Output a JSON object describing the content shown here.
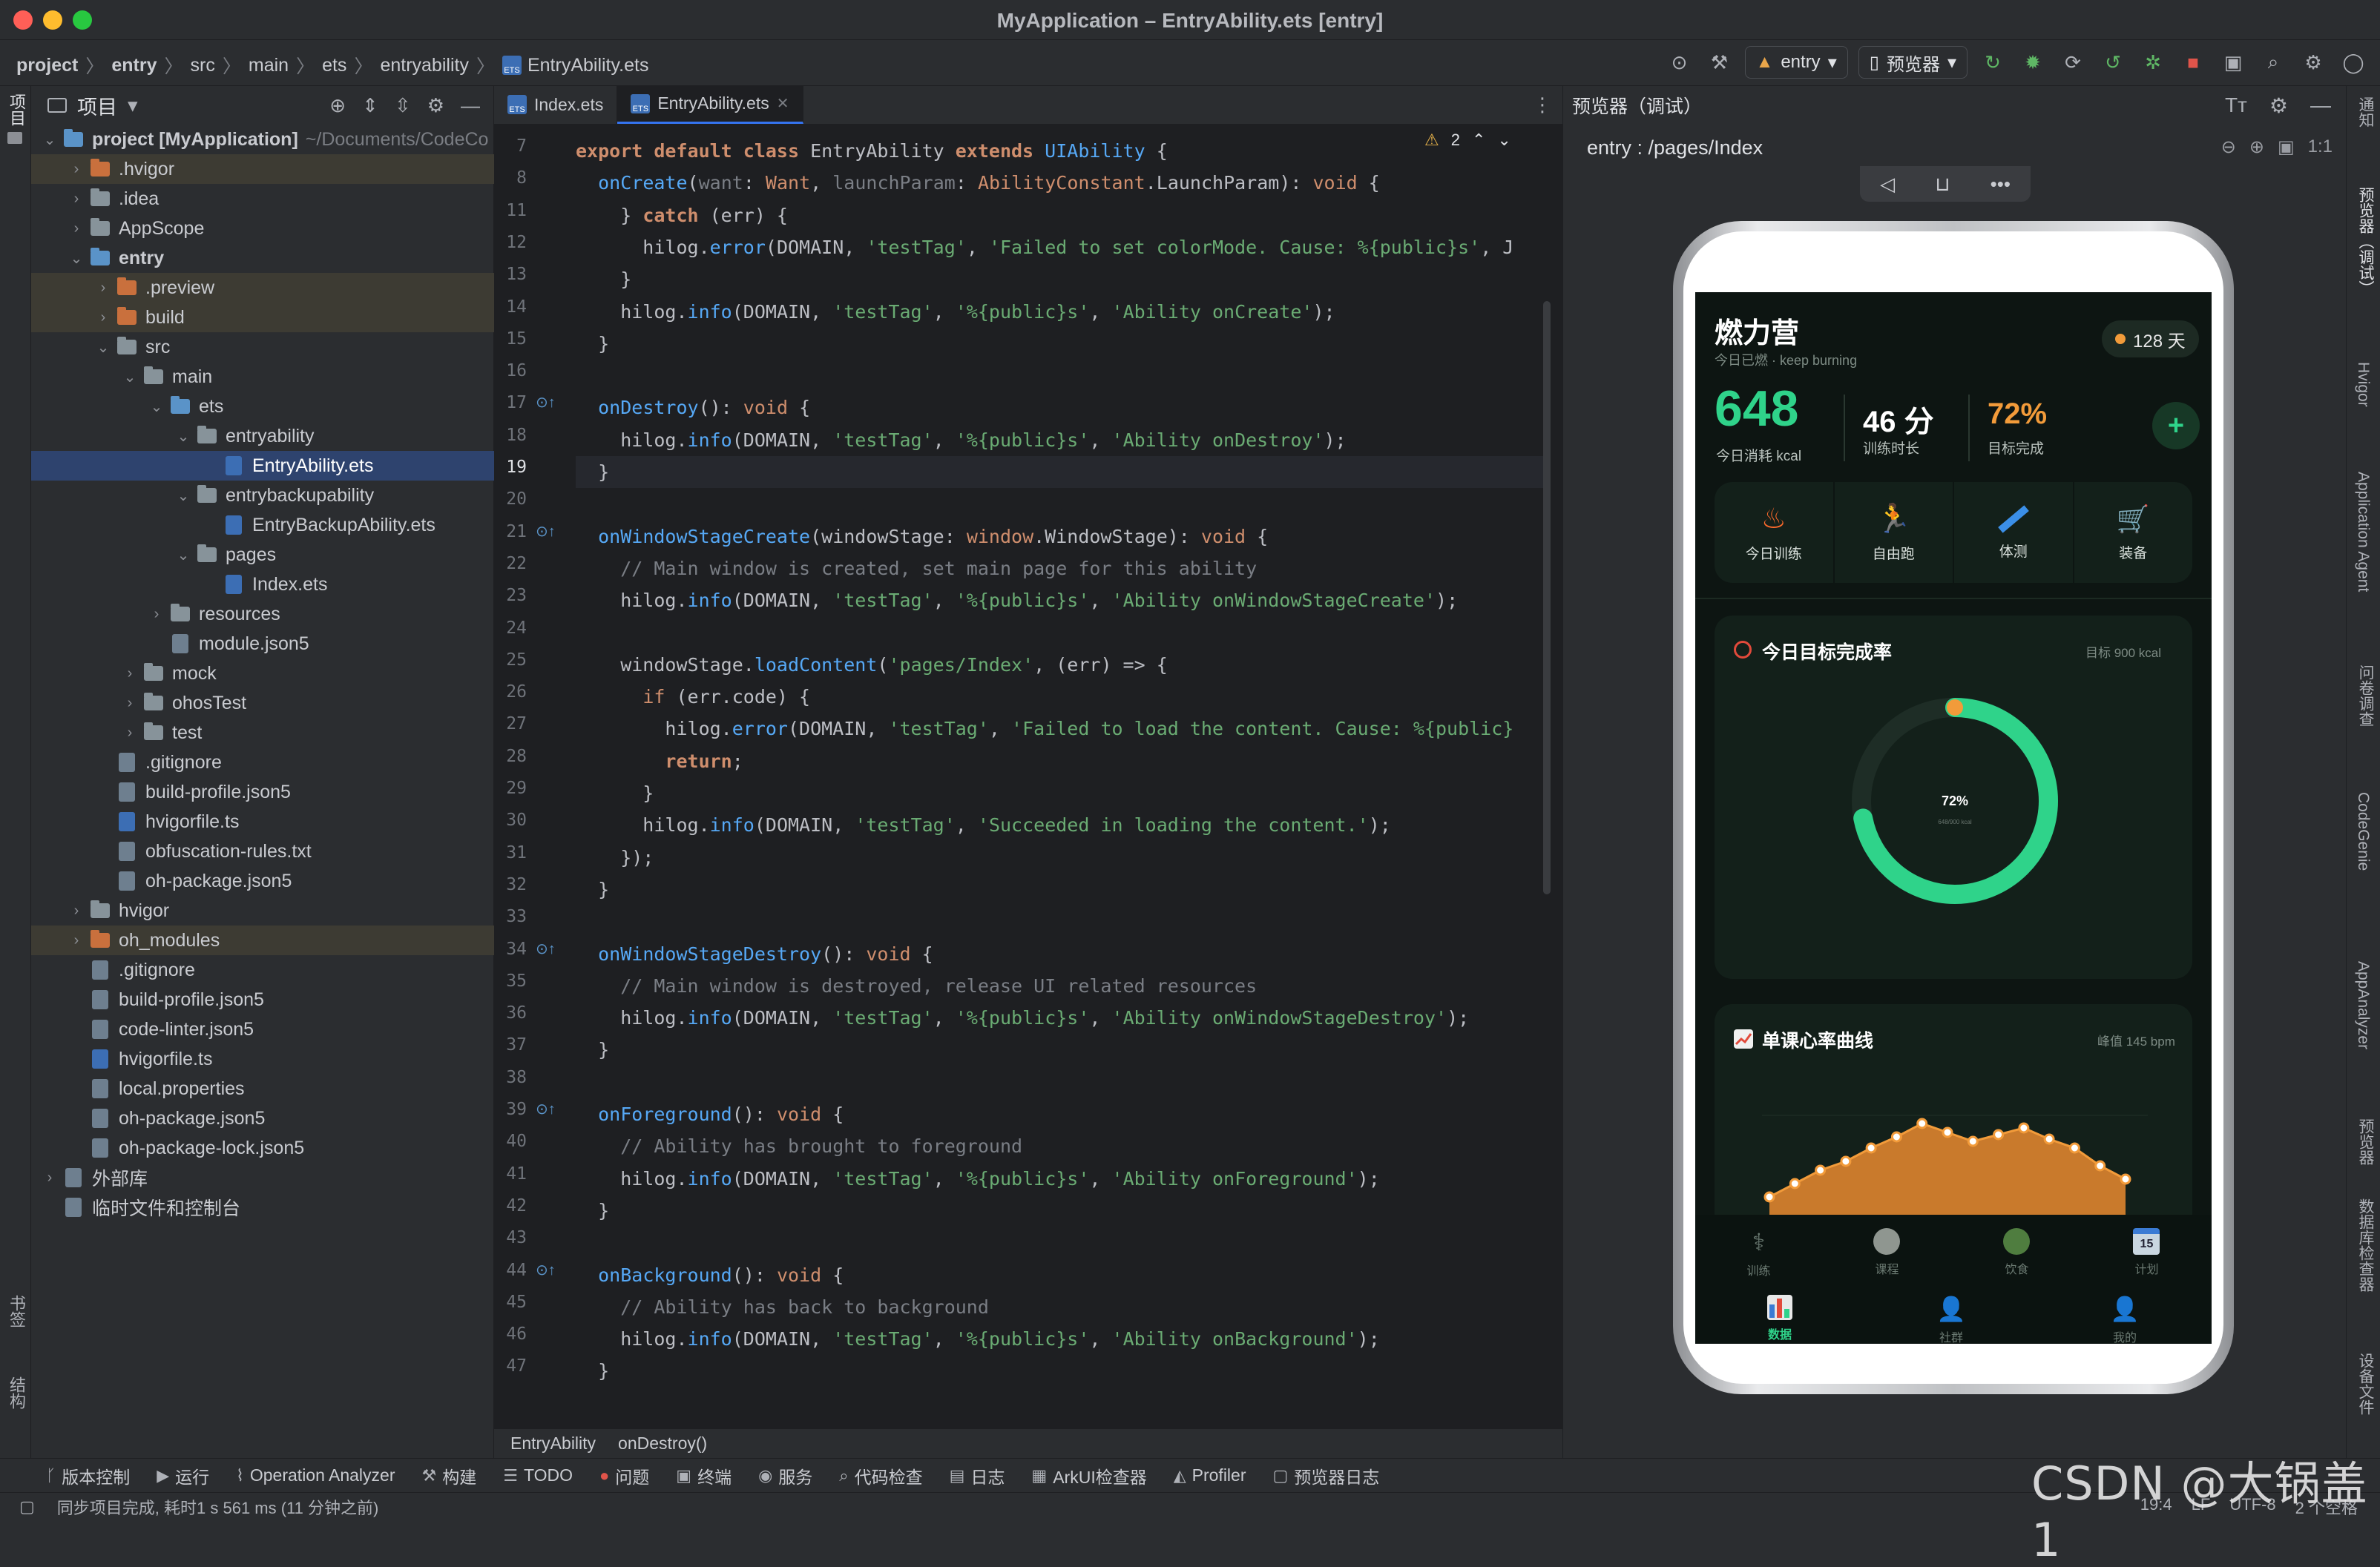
{
  "window": {
    "title": "MyApplication – EntryAbility.ets [entry]"
  },
  "breadcrumb": [
    "project",
    "entry",
    "src",
    "main",
    "ets",
    "entryability",
    "EntryAbility.ets"
  ],
  "toolbar": {
    "run_config": "entry",
    "device": "预览器"
  },
  "left_strip": {
    "project": "项目",
    "bookmarks": "书签",
    "structure": "结构"
  },
  "project_panel": {
    "title": "项目",
    "tree": [
      {
        "label": "project [MyApplication]",
        "extra": "~/Documents/CodeCo",
        "depth": 0,
        "icon": "module",
        "open": true,
        "bold": true
      },
      {
        "label": ".hvigor",
        "depth": 1,
        "icon": "folder-orange",
        "open": false,
        "hl": true
      },
      {
        "label": ".idea",
        "depth": 1,
        "icon": "folder",
        "open": false
      },
      {
        "label": "AppScope",
        "depth": 1,
        "icon": "folder",
        "open": false
      },
      {
        "label": "entry",
        "depth": 1,
        "icon": "module",
        "open": true,
        "bold": true
      },
      {
        "label": ".preview",
        "depth": 2,
        "icon": "folder-orange",
        "open": false,
        "hl": true
      },
      {
        "label": "build",
        "depth": 2,
        "icon": "folder-orange",
        "open": false,
        "hl": true
      },
      {
        "label": "src",
        "depth": 2,
        "icon": "folder",
        "open": true
      },
      {
        "label": "main",
        "depth": 3,
        "icon": "folder",
        "open": true
      },
      {
        "label": "ets",
        "depth": 4,
        "icon": "folder-blue",
        "open": true
      },
      {
        "label": "entryability",
        "depth": 5,
        "icon": "folder",
        "open": true
      },
      {
        "label": "EntryAbility.ets",
        "depth": 6,
        "icon": "ts",
        "sel": true
      },
      {
        "label": "entrybackupability",
        "depth": 5,
        "icon": "folder",
        "open": true
      },
      {
        "label": "EntryBackupAbility.ets",
        "depth": 6,
        "icon": "ts"
      },
      {
        "label": "pages",
        "depth": 5,
        "icon": "folder",
        "open": true
      },
      {
        "label": "Index.ets",
        "depth": 6,
        "icon": "ts"
      },
      {
        "label": "resources",
        "depth": 4,
        "icon": "folder",
        "open": false
      },
      {
        "label": "module.json5",
        "depth": 4,
        "icon": "file"
      },
      {
        "label": "mock",
        "depth": 3,
        "icon": "folder",
        "open": false
      },
      {
        "label": "ohosTest",
        "depth": 3,
        "icon": "folder",
        "open": false
      },
      {
        "label": "test",
        "depth": 3,
        "icon": "folder",
        "open": false
      },
      {
        "label": ".gitignore",
        "depth": 2,
        "icon": "file"
      },
      {
        "label": "build-profile.json5",
        "depth": 2,
        "icon": "file"
      },
      {
        "label": "hvigorfile.ts",
        "depth": 2,
        "icon": "ts"
      },
      {
        "label": "obfuscation-rules.txt",
        "depth": 2,
        "icon": "file"
      },
      {
        "label": "oh-package.json5",
        "depth": 2,
        "icon": "file"
      },
      {
        "label": "hvigor",
        "depth": 1,
        "icon": "folder",
        "open": false
      },
      {
        "label": "oh_modules",
        "depth": 1,
        "icon": "folder-orange",
        "open": false,
        "hl": true
      },
      {
        "label": ".gitignore",
        "depth": 1,
        "icon": "file"
      },
      {
        "label": "build-profile.json5",
        "depth": 1,
        "icon": "file"
      },
      {
        "label": "code-linter.json5",
        "depth": 1,
        "icon": "file"
      },
      {
        "label": "hvigorfile.ts",
        "depth": 1,
        "icon": "ts"
      },
      {
        "label": "local.properties",
        "depth": 1,
        "icon": "file"
      },
      {
        "label": "oh-package.json5",
        "depth": 1,
        "icon": "file"
      },
      {
        "label": "oh-package-lock.json5",
        "depth": 1,
        "icon": "file"
      },
      {
        "label": "外部库",
        "depth": 0,
        "icon": "lib",
        "open": false
      },
      {
        "label": "临时文件和控制台",
        "depth": 0,
        "icon": "scratch"
      }
    ]
  },
  "editor": {
    "tabs": [
      {
        "label": "Index.ets",
        "active": false
      },
      {
        "label": "EntryAbility.ets",
        "active": true
      }
    ],
    "warnings": "2",
    "current_line": 19,
    "lines": [
      {
        "n": "7",
        "html": "<span class='kw'>export default class</span> EntryAbility <span class='kw'>extends</span> <span class='fn'>UIAbility</span> {"
      },
      {
        "n": "8",
        "html": "  <span class='fn'>onCreate</span>(<span class='cm'>want</span>: <span class='kw2'>Want</span>, <span class='cm'>launchParam</span>: <span class='kw2'>AbilityConstant</span>.LaunchParam): <span class='kw2'>void</span> {"
      },
      {
        "n": "11",
        "html": "    } <span class='kw'>catch</span> (err) {"
      },
      {
        "n": "12",
        "html": "      hilog.<span class='fn'>error</span>(DOMAIN, <span class='st'>'testTag'</span>, <span class='st'>'Failed to set colorMode. Cause: %{public}s'</span>, J"
      },
      {
        "n": "13",
        "html": "    }"
      },
      {
        "n": "14",
        "html": "    hilog.<span class='fn'>info</span>(DOMAIN, <span class='st'>'testTag'</span>, <span class='st'>'%{public}s'</span>, <span class='st'>'Ability onCreate'</span>);"
      },
      {
        "n": "15",
        "html": "  }"
      },
      {
        "n": "16",
        "html": ""
      },
      {
        "n": "17",
        "html": "  <span class='fn'>onDestroy</span>(): <span class='kw2'>void</span> {"
      },
      {
        "n": "18",
        "html": "    hilog.<span class='fn'>info</span>(DOMAIN, <span class='st'>'testTag'</span>, <span class='st'>'%{public}s'</span>, <span class='st'>'Ability onDestroy'</span>);"
      },
      {
        "n": "19",
        "html": "  }"
      },
      {
        "n": "20",
        "html": ""
      },
      {
        "n": "21",
        "html": "  <span class='fn'>onWindowStageCreate</span>(windowStage: <span class='kw2'>window</span>.WindowStage): <span class='kw2'>void</span> {"
      },
      {
        "n": "22",
        "html": "    <span class='cm'>// Main window is created, set main page for this ability</span>"
      },
      {
        "n": "23",
        "html": "    hilog.<span class='fn'>info</span>(DOMAIN, <span class='st'>'testTag'</span>, <span class='st'>'%{public}s'</span>, <span class='st'>'Ability onWindowStageCreate'</span>);"
      },
      {
        "n": "24",
        "html": ""
      },
      {
        "n": "25",
        "html": "    windowStage.<span class='fn'>loadContent</span>(<span class='st'>'pages/Index'</span>, (err) =&gt; {"
      },
      {
        "n": "26",
        "html": "      <span class='kw2'>if</span> (err.code) {"
      },
      {
        "n": "27",
        "html": "        hilog.<span class='fn'>error</span>(DOMAIN, <span class='st'>'testTag'</span>, <span class='st'>'Failed to load the content. Cause: %{public}</span>"
      },
      {
        "n": "28",
        "html": "        <span class='kw'>return</span>;"
      },
      {
        "n": "29",
        "html": "      }"
      },
      {
        "n": "30",
        "html": "      hilog.<span class='fn'>info</span>(DOMAIN, <span class='st'>'testTag'</span>, <span class='st'>'Succeeded in loading the content.'</span>);"
      },
      {
        "n": "31",
        "html": "    });"
      },
      {
        "n": "32",
        "html": "  }"
      },
      {
        "n": "33",
        "html": ""
      },
      {
        "n": "34",
        "html": "  <span class='fn'>onWindowStageDestroy</span>(): <span class='kw2'>void</span> {"
      },
      {
        "n": "35",
        "html": "    <span class='cm'>// Main window is destroyed, release UI related resources</span>"
      },
      {
        "n": "36",
        "html": "    hilog.<span class='fn'>info</span>(DOMAIN, <span class='st'>'testTag'</span>, <span class='st'>'%{public}s'</span>, <span class='st'>'Ability onWindowStageDestroy'</span>);"
      },
      {
        "n": "37",
        "html": "  }"
      },
      {
        "n": "38",
        "html": ""
      },
      {
        "n": "39",
        "html": "  <span class='fn'>onForeground</span>(): <span class='kw2'>void</span> {"
      },
      {
        "n": "40",
        "html": "    <span class='cm'>// Ability has brought to foreground</span>"
      },
      {
        "n": "41",
        "html": "    hilog.<span class='fn'>info</span>(DOMAIN, <span class='st'>'testTag'</span>, <span class='st'>'%{public}s'</span>, <span class='st'>'Ability onForeground'</span>);"
      },
      {
        "n": "42",
        "html": "  }"
      },
      {
        "n": "43",
        "html": ""
      },
      {
        "n": "44",
        "html": "  <span class='fn'>onBackground</span>(): <span class='kw2'>void</span> {"
      },
      {
        "n": "45",
        "html": "    <span class='cm'>// Ability has back to background</span>"
      },
      {
        "n": "46",
        "html": "    hilog.<span class='fn'>info</span>(DOMAIN, <span class='st'>'testTag'</span>, <span class='st'>'%{public}s'</span>, <span class='st'>'Ability onBackground'</span>);"
      },
      {
        "n": "47",
        "html": "  }"
      }
    ],
    "crumbs": [
      "EntryAbility",
      "onDestroy()"
    ]
  },
  "preview": {
    "title": "预览器（调试）",
    "route": "entry : /pages/Index",
    "zoom_label": "1:1",
    "app": {
      "name": "燃力营",
      "subtitle": "今日已燃 · keep burning",
      "streak": "128 天",
      "kcal": "648",
      "kcal_label": "今日消耗 kcal",
      "minutes": "46 分",
      "minutes_label": "训练时长",
      "goal_pct": "72%",
      "goal_label": "目标完成",
      "plus": "+",
      "quick": [
        "今日训练",
        "自由跑",
        "体测",
        "装备"
      ],
      "ring_title": "今日目标完成率",
      "ring_target": "目标 900 kcal",
      "ring_value": 0.72,
      "ring_center": "72%",
      "ring_sub": "648/900 kcal",
      "hr_title": "单课心率曲线",
      "hr_peak": "峰值 145 bpm",
      "hr_values": [
        112,
        118,
        124,
        128,
        134,
        139,
        145,
        141,
        137,
        140,
        143,
        138,
        134,
        126,
        120
      ],
      "tabs_top": [
        "训练",
        "课程",
        "饮食",
        "计划"
      ],
      "tabs_bottom": [
        "数据",
        "社群",
        "我的"
      ],
      "active_tab": "数据",
      "calendar_day": "15"
    }
  },
  "right_strip": [
    "通知",
    "预览器（调试）",
    "Hvigor",
    "Application Agent",
    "问卷调查",
    "CodeGenie",
    "AppAnalyzer",
    "预览器",
    "数据库检查器",
    "设备文件"
  ],
  "tool_windows": [
    "版本控制",
    "运行",
    "Operation Analyzer",
    "构建",
    "TODO",
    "问题",
    "终端",
    "服务",
    "代码检查",
    "日志",
    "ArkUI检查器",
    "Profiler",
    "预览器日志"
  ],
  "status": {
    "message": "同步项目完成, 耗时1 s 561 ms (11 分钟之前)",
    "position": "19:4",
    "line_sep": "LF",
    "encoding": "UTF-8",
    "indent": "2 个空格"
  },
  "watermark": "CSDN @大锅盖1",
  "colors": {
    "accent": "#3574f0",
    "app_green": "#2fd38a",
    "app_orange": "#f29b3a"
  }
}
